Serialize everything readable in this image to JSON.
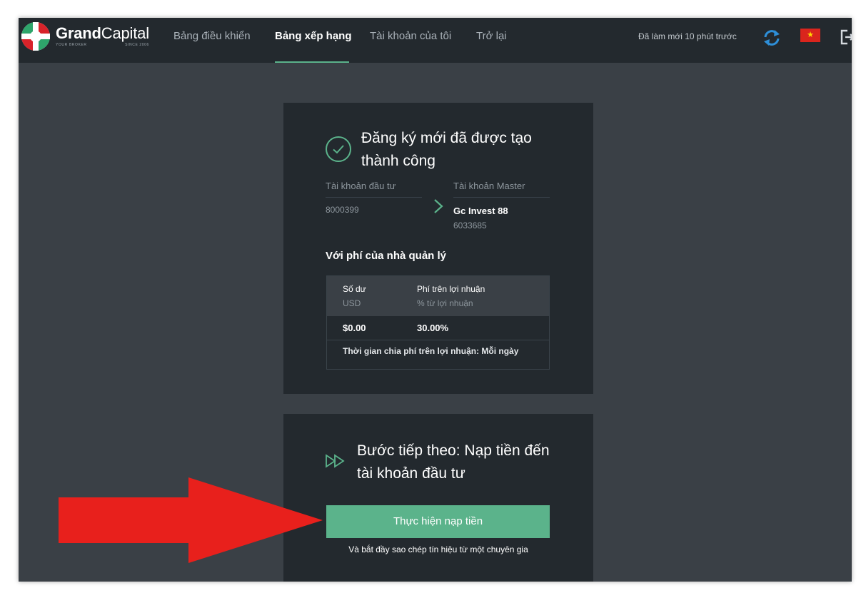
{
  "header": {
    "brand": {
      "name_bold": "Grand",
      "name_light": "Capital",
      "tagline_left": "YOUR BROKER",
      "tagline_right": "SINCE 2006"
    },
    "nav": [
      {
        "label": "Bảng điều khiển"
      },
      {
        "label": "Bảng xếp hạng"
      },
      {
        "label": "Tài khoản của tôi"
      },
      {
        "label": "Trở lại"
      }
    ],
    "refresh_text": "Đã làm mới 10 phút trước",
    "icons": {
      "refresh": "sync-icon",
      "language": "vietnam-flag-icon",
      "logout": "logout-icon"
    }
  },
  "subscription": {
    "title": "Đăng ký mới đã được tạo thành công",
    "investor_label": "Tài khoản đầu tư",
    "investor_number": "8000399",
    "master_label": "Tài khoản Master",
    "master_name": "Gc Invest 88",
    "master_number": "6033685",
    "fee_heading": "Với phí của nhà quản lý",
    "table": {
      "col1": "Số dư",
      "col1_sub": "USD",
      "col2": "Phí trên lợi nhuận",
      "col2_sub": "% từ lợi nhuận",
      "balance": "$0.00",
      "fee": "30.00%",
      "period": "Thời gian chia phí trên lợi nhuận: Mỗi ngày"
    }
  },
  "next_step": {
    "title": "Bước tiếp theo: Nạp tiền đến tài khoản đầu tư",
    "button": "Thực hiện nạp tiền",
    "note": "Và bắt đầy sao chép tín hiệu từ một chuyên gia"
  },
  "colors": {
    "accent": "#5bb38b",
    "panel": "#23292e",
    "background": "#3a4046",
    "annotation": "#e8201c"
  }
}
